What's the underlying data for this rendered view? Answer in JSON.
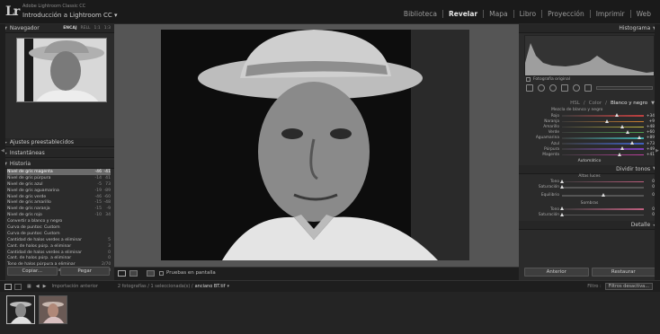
{
  "app": {
    "logo": "Lr",
    "subtitle": "Adobe Lightroom Classic CC",
    "catalog": "Introducción a Lightroom CC ▾"
  },
  "modules": [
    "Biblioteca",
    "Revelar",
    "Mapa",
    "Libro",
    "Proyección",
    "Imprimir",
    "Web"
  ],
  "left": {
    "navigator": {
      "title": "Navegador",
      "zoom_options": [
        "ENCAJ",
        "RELL",
        "1:1",
        "1:3"
      ]
    },
    "presets_title": "Ajustes preestablecidos",
    "snapshots_title": "Instantáneas",
    "history_title": "Historia",
    "history": [
      {
        "label": "Nivel de gris magenta",
        "v1": "-46",
        "v2": "-41"
      },
      {
        "label": "Nivel de gris púrpura",
        "v1": "-14",
        "v2": "41"
      },
      {
        "label": "Nivel de gris azul",
        "v1": "-5",
        "v2": "73"
      },
      {
        "label": "Nivel de gris aguamarina",
        "v1": "-19",
        "v2": "-89"
      },
      {
        "label": "Nivel de gris verde",
        "v1": "-46",
        "v2": "-60"
      },
      {
        "label": "Nivel de gris amarillo",
        "v1": "-15",
        "v2": "-48"
      },
      {
        "label": "Nivel de gris naranja",
        "v1": "-15",
        "v2": "-9"
      },
      {
        "label": "Nivel de gris rojo",
        "v1": "-10",
        "v2": "34"
      },
      {
        "label": "Convertir a blanco y negro",
        "v1": "",
        "v2": ""
      },
      {
        "label": "Curva de puntos: Custom",
        "v1": "",
        "v2": ""
      },
      {
        "label": "Curva de puntos: Custom",
        "v1": "",
        "v2": ""
      },
      {
        "label": "Cantidad de halos verdes a eliminar",
        "v1": "",
        "v2": "5"
      },
      {
        "label": "Cant. de halos púrp. a eliminar",
        "v1": "",
        "v2": "3"
      },
      {
        "label": "Cantidad de halos verdes a eliminar",
        "v1": "",
        "v2": "0"
      },
      {
        "label": "Cant. de halos púrp. a eliminar",
        "v1": "",
        "v2": "0"
      },
      {
        "label": "Tono de halos púrpura a eliminar",
        "v1": "",
        "v2": "2/70"
      },
      {
        "label": "Cant. de halos púrp. a eliminar",
        "v1": "",
        "v2": "3"
      }
    ],
    "copy_button": "Copiar...",
    "paste_button": "Pegar"
  },
  "center": {
    "toolbar_label": "Pruebas en pantalla"
  },
  "right": {
    "histogram_title": "Histograma",
    "original_photo": "Fotografía original",
    "hsl_tabs": [
      "HSL",
      "/",
      "Color",
      "/",
      "Blanco y negro"
    ],
    "mix_label": "Mezcla de blanco y negro",
    "mix": [
      {
        "label": "Rojo",
        "value": "+34",
        "pos": 0.67,
        "color": "#c04040"
      },
      {
        "label": "Naranja",
        "value": "+9",
        "pos": 0.55,
        "color": "#d08030"
      },
      {
        "label": "Amarillo",
        "value": "+48",
        "pos": 0.74,
        "color": "#c8c040"
      },
      {
        "label": "Verde",
        "value": "+60",
        "pos": 0.8,
        "color": "#50a050"
      },
      {
        "label": "Aguamarina",
        "value": "+89",
        "pos": 0.94,
        "color": "#40b0b0"
      },
      {
        "label": "Azul",
        "value": "+73",
        "pos": 0.86,
        "color": "#4060c0"
      },
      {
        "label": "Púrpura",
        "value": "+49",
        "pos": 0.74,
        "color": "#8040c0"
      },
      {
        "label": "Magenta",
        "value": "+41",
        "pos": 0.7,
        "color": "#c040a0"
      }
    ],
    "auto_label": "Automático",
    "split_title": "Dividir tonos",
    "highlights_label": "Altas luces",
    "highlights": [
      {
        "label": "Tono",
        "value": "0",
        "pos": 0.0
      },
      {
        "label": "Saturación",
        "value": "0",
        "pos": 0.0
      }
    ],
    "balance": {
      "label": "Equilibrio",
      "value": "0",
      "pos": 0.5
    },
    "shadows_label": "Sombras",
    "shadows": [
      {
        "label": "Tono",
        "value": "0",
        "pos": 0.0
      },
      {
        "label": "Saturación",
        "value": "0",
        "pos": 0.0
      }
    ],
    "detail_title": "Detalle",
    "prev_button": "Anterior",
    "reset_button": "Restaurar"
  },
  "filmstrip": {
    "source": "Importación anterior",
    "info": "2 fotografías / 1 seleccionada(s) /",
    "filename": "anciano BT.tif",
    "filter_label": "Filtro :",
    "filter_value": "Filtros desactiva..."
  }
}
